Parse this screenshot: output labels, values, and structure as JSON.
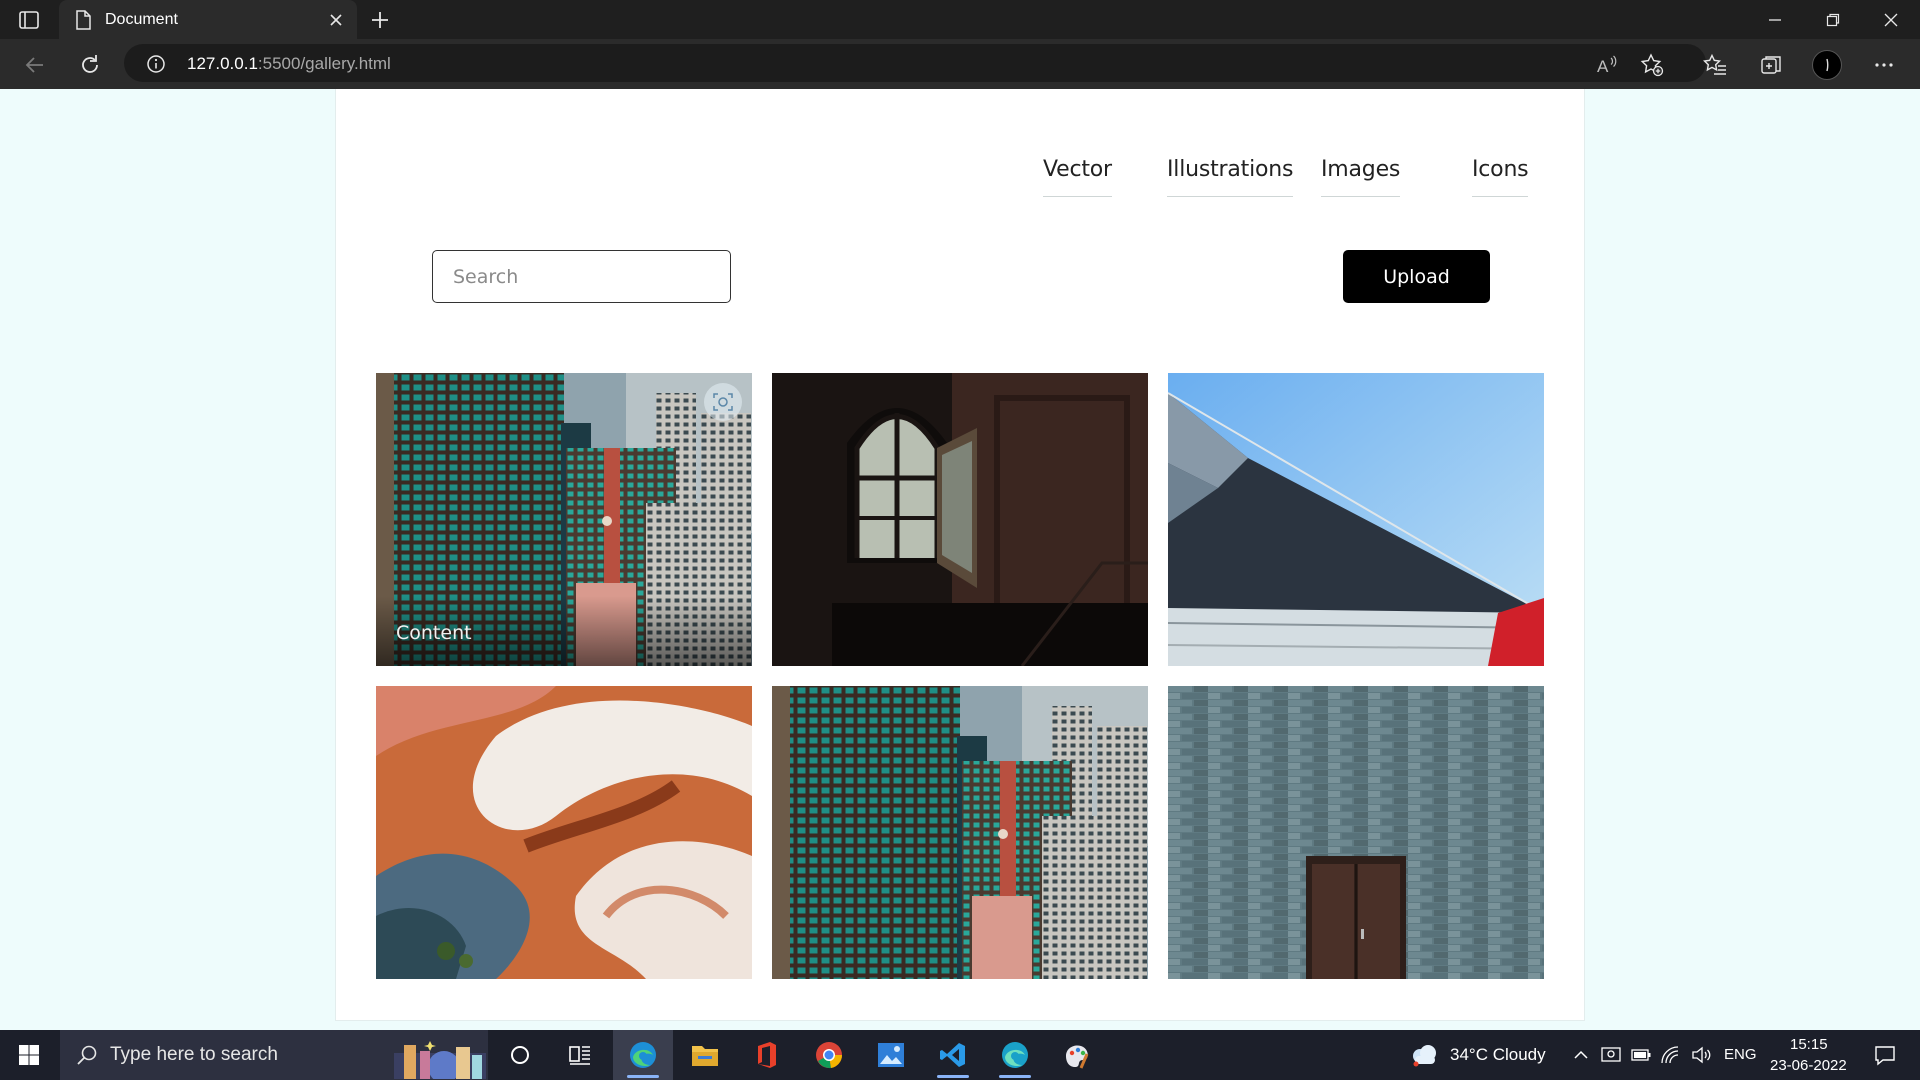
{
  "browser": {
    "tab_title": "Document",
    "url_host": "127.0.0.1",
    "url_rest": ":5500/gallery.html"
  },
  "nav": {
    "links": [
      "Vector",
      "Illustrations",
      "Images",
      "Icons"
    ]
  },
  "toolbar": {
    "search_placeholder": "Search",
    "upload_label": "Upload"
  },
  "gallery": {
    "items": [
      {
        "subject": "apartment-towers",
        "caption": "Content"
      },
      {
        "subject": "dark-room-window"
      },
      {
        "subject": "angled-roof-blue-sky"
      },
      {
        "subject": "aerial-sand-river"
      },
      {
        "subject": "apartment-towers"
      },
      {
        "subject": "stone-wall-door"
      }
    ]
  },
  "taskbar": {
    "search_placeholder": "Type here to search",
    "weather": "34°C  Cloudy",
    "language": "ENG",
    "time": "15:15",
    "date": "23-06-2022"
  }
}
